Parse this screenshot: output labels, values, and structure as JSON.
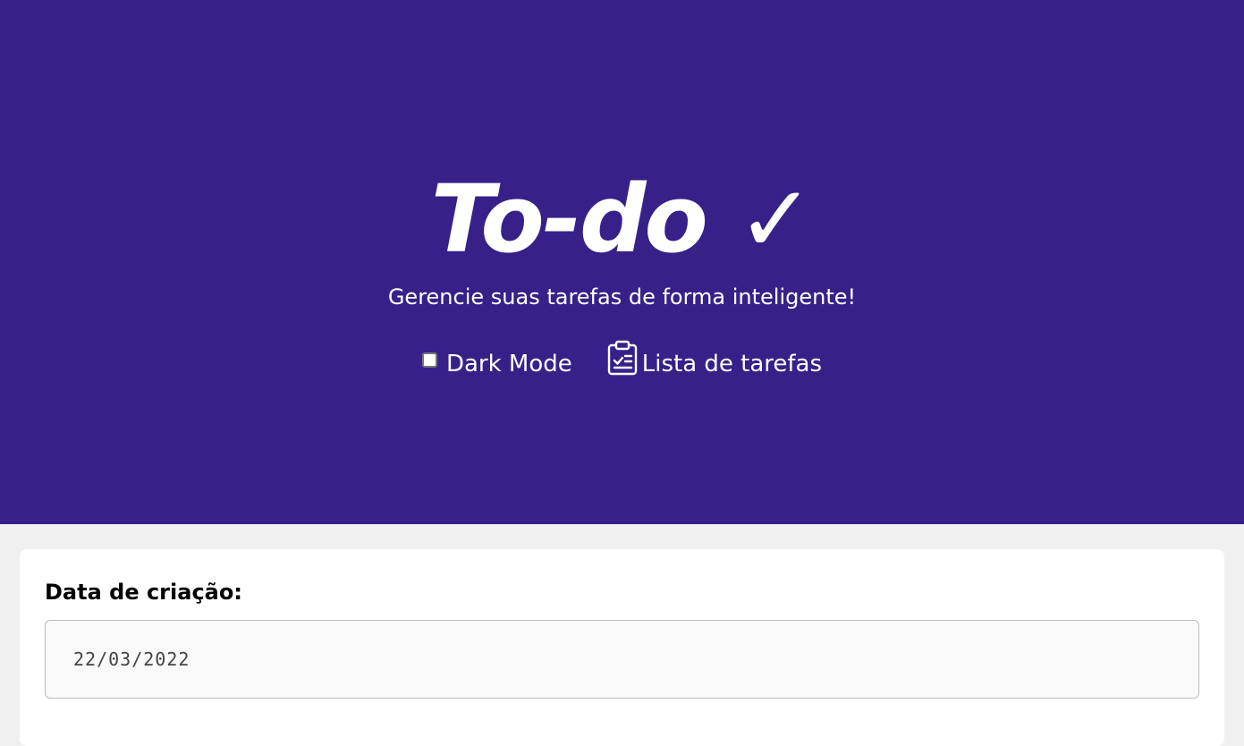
{
  "header": {
    "title": "To-do ✓",
    "subtitle": "Gerencie suas tarefas de forma inteligente!",
    "dark_mode_label": "Dark Mode",
    "dark_mode_checked": false,
    "task_list_label": "Lista de tarefas",
    "task_list_icon": "clipboard-check-icon"
  },
  "form": {
    "creation_date_label": "Data de criação:",
    "creation_date_value": "22/03/2022"
  },
  "colors": {
    "header_bg": "#372189",
    "page_bg": "#f0f0f0",
    "card_bg": "#ffffff"
  }
}
